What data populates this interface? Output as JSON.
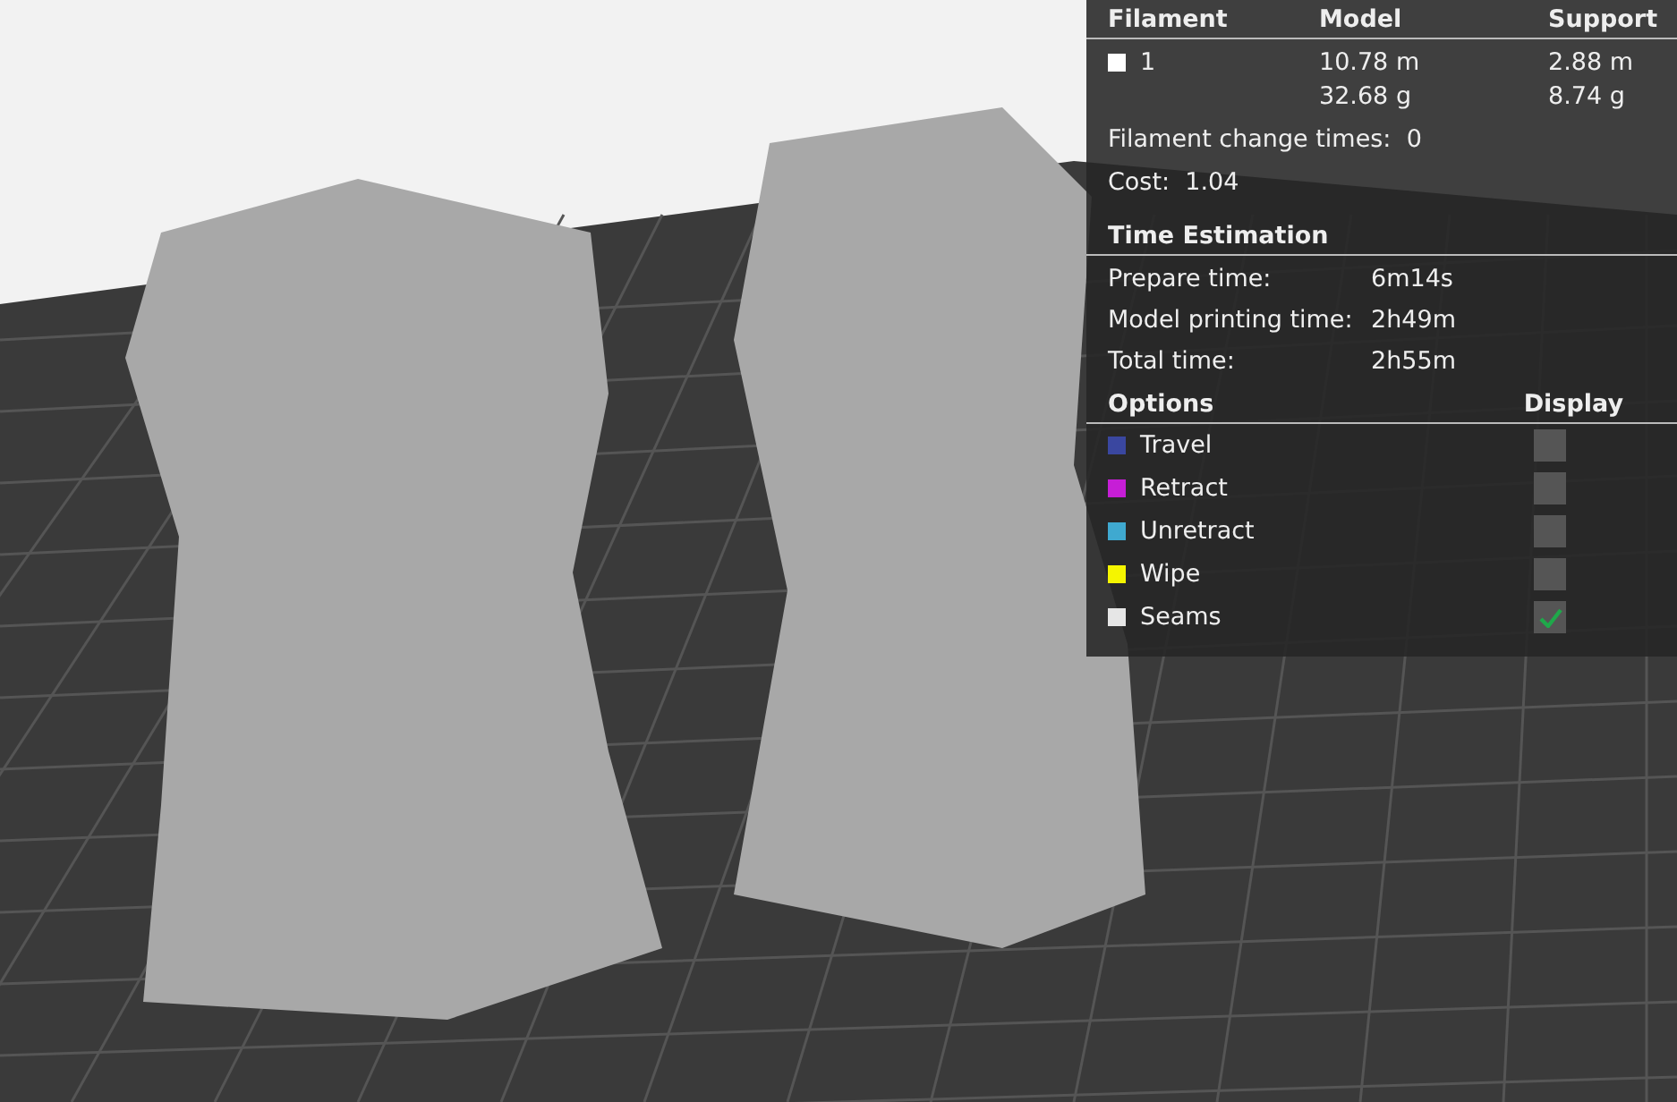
{
  "filament_table": {
    "columns": [
      "Filament",
      "Model",
      "Support"
    ],
    "rows": [
      {
        "color": "#ffffff",
        "name": "1",
        "model": [
          "10.78 m",
          "32.68 g"
        ],
        "support": [
          "2.88 m",
          "8.74 g"
        ]
      }
    ]
  },
  "summary": [
    {
      "label": "Filament change times:",
      "value": "0"
    },
    {
      "label": "Cost:",
      "value": "1.04"
    }
  ],
  "time_estimation": {
    "title": "Time Estimation",
    "rows": [
      {
        "label": "Prepare time:",
        "value": "6m14s"
      },
      {
        "label": "Model printing time:",
        "value": "2h49m"
      },
      {
        "label": "Total time:",
        "value": "2h55m"
      }
    ]
  },
  "options": {
    "title": "Options",
    "display_title": "Display",
    "items": [
      {
        "label": "Travel",
        "color": "#3a47a0",
        "checked": false
      },
      {
        "label": "Retract",
        "color": "#c61ed6",
        "checked": false
      },
      {
        "label": "Unretract",
        "color": "#3fa9d0",
        "checked": false
      },
      {
        "label": "Wipe",
        "color": "#f5f500",
        "checked": false
      },
      {
        "label": "Seams",
        "color": "#e6e6e6",
        "checked": true
      }
    ]
  }
}
